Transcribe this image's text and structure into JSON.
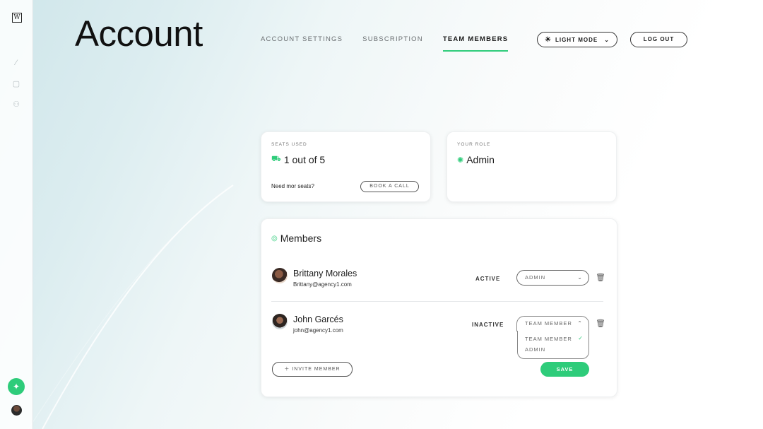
{
  "app": {
    "logo_letter": "W"
  },
  "sidebar": {
    "icons": [
      "magic-wand-icon",
      "document-icon",
      "users-icon"
    ],
    "action_icon": "magic-icon"
  },
  "header": {
    "title": "Account",
    "tabs": [
      {
        "label": "ACCOUNT SETTINGS",
        "active": false
      },
      {
        "label": "SUBSCRIPTION",
        "active": false
      },
      {
        "label": "TEAM MEMBERS",
        "active": true
      }
    ],
    "mode_select": {
      "value": "LIGHT MODE",
      "icon": "sun-icon"
    },
    "logout_label": "LOG OUT"
  },
  "seats": {
    "label": "SEATS USED",
    "value": "1 out of 5",
    "note": "Need mor seats?",
    "button": "BOOK A CALL"
  },
  "role": {
    "label": "YOUR ROLE",
    "value": "Admin"
  },
  "members": {
    "title": "Members",
    "list": [
      {
        "name": "Brittany Morales",
        "email": "Brittany@agency1.com",
        "status": "ACTIVE",
        "role": "ADMIN"
      },
      {
        "name": "John Garcés",
        "email": "john@agency1.com",
        "status": "INACTIVE",
        "role": "TEAM MEMBER"
      }
    ],
    "dropdown_options": [
      "TEAM MEMBER",
      "ADMIN"
    ],
    "invite_label": "INVITE MEMBER",
    "save_label": "SAVE"
  },
  "colors": {
    "accent": "#2ecc7a"
  }
}
